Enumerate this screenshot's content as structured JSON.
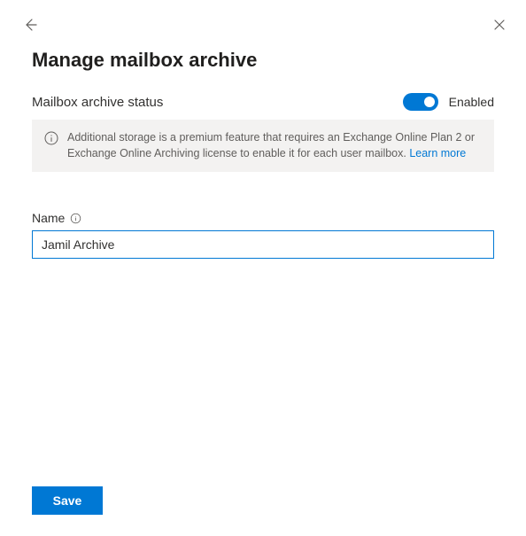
{
  "header": {
    "title": "Manage mailbox archive"
  },
  "status": {
    "label": "Mailbox archive status",
    "toggle_state": "Enabled"
  },
  "info": {
    "text": "Additional storage is a premium feature that requires an Exchange Online Plan 2 or Exchange Online Archiving license to enable it for each user mailbox. ",
    "link_text": "Learn more"
  },
  "name_field": {
    "label": "Name",
    "value": "Jamil Archive"
  },
  "footer": {
    "save_label": "Save"
  }
}
